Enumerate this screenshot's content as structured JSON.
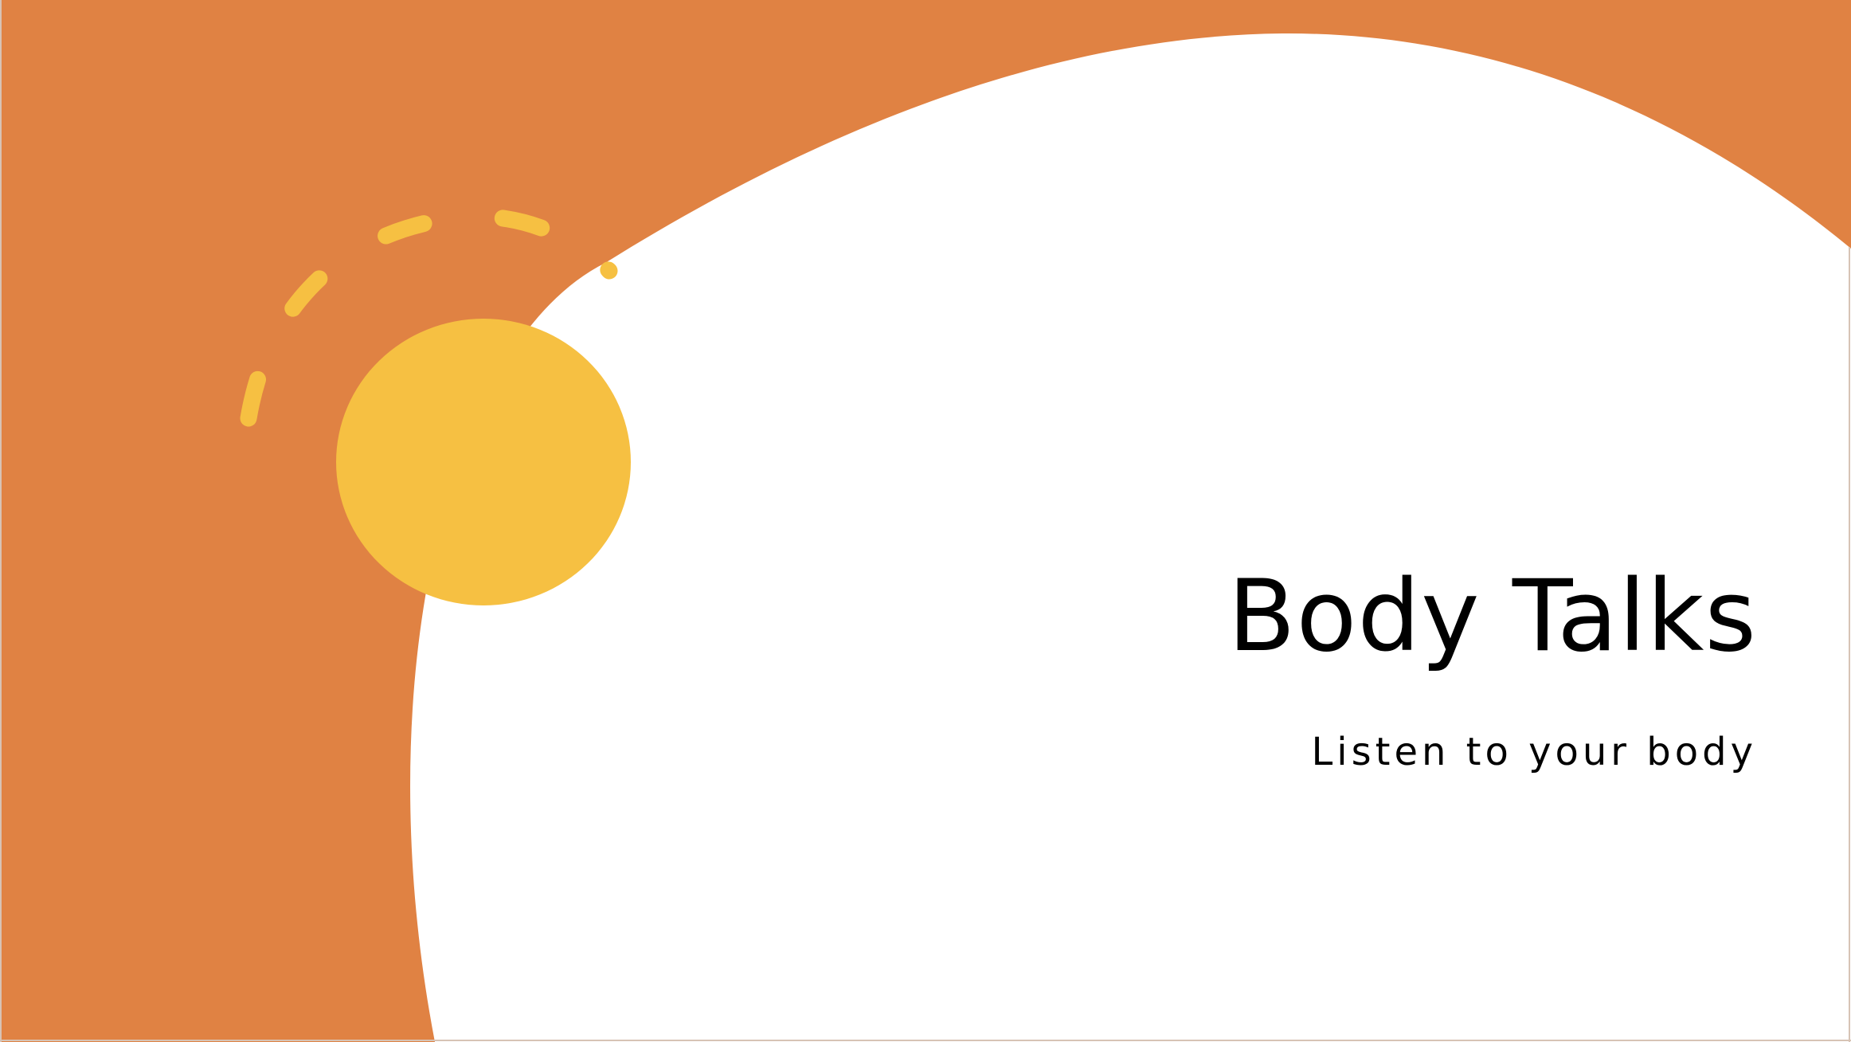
{
  "slide": {
    "title": "Body Talks",
    "subtitle": "Listen to your body"
  },
  "colors": {
    "background_accent": "#E08243",
    "sun": "#F6C042",
    "canvas": "#FFFFFF",
    "text": "#000000"
  },
  "icons": {
    "sun": "sun-circle-icon",
    "arc": "dashed-arc-icon"
  }
}
